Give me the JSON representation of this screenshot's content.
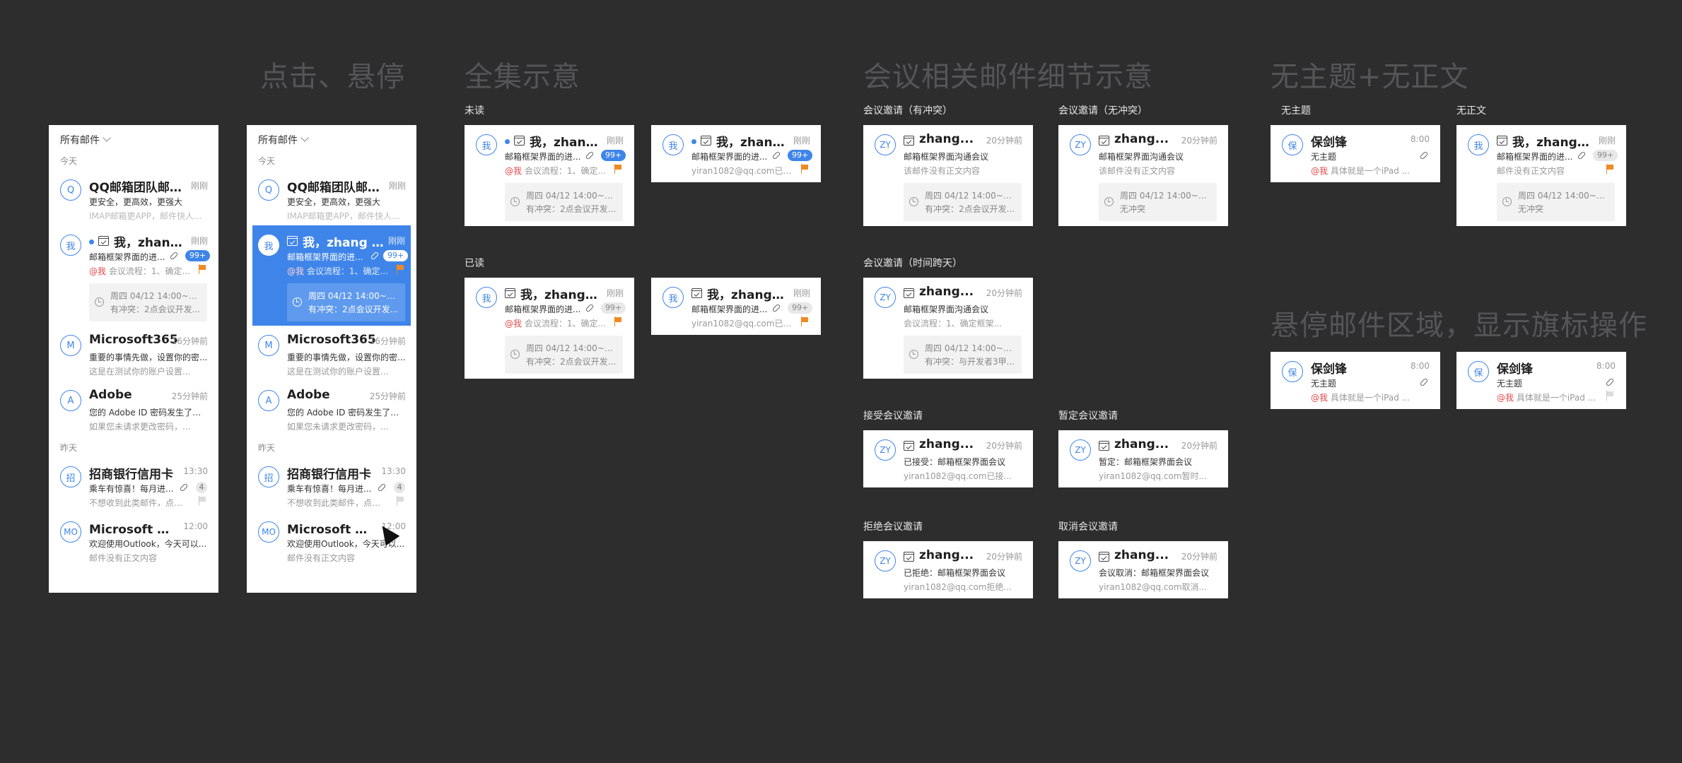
{
  "sections": {
    "hover": "点击、悬停",
    "overview": "全集示意",
    "meeting": "会议相关邮件细节示意",
    "empty": "无主题+无正文",
    "hover_flag": "悬停邮件区域，显示旗标操作"
  },
  "labels": {
    "unread": "未读",
    "read": "已读",
    "conflict": "会议邀请（有冲突）",
    "noconflict": "会议邀请（无冲突）",
    "crossday": "会议邀请（时间跨天）",
    "accept": "接受会议邀请",
    "tentative": "暂定会议邀请",
    "decline": "拒绝会议邀请",
    "cancel": "取消会议邀请",
    "nosubject": "无主题",
    "nobody": "无正文"
  },
  "panel": {
    "folder": "所有邮件",
    "today": "今天",
    "yesterday": "昨天",
    "mails": [
      {
        "avatar": "Q",
        "sender": "QQ邮箱团队邮箱...",
        "time": "刚刚",
        "subject": "更安全，更高效，更强大",
        "preview": "IMAP邮箱更APP，邮件快人..."
      },
      {
        "avatar": "我",
        "sender": "我，zhang...",
        "sender_sel": "我，zhang Yi...",
        "time": "刚刚",
        "subject": "邮箱框架界面的进...",
        "badge": "99+",
        "at": "@我",
        "preview": "会议流程：1、确定...",
        "mtg1": "周四 04/12 14:00~17...",
        "mtg2": "有冲突：2点会议开发..."
      },
      {
        "avatar": "M",
        "sender": "Microsoft365",
        "time": "16分钟前",
        "subject": "重要的事情先做，设置你的密...",
        "preview": "这是在测试你的账户设置..."
      },
      {
        "avatar": "A",
        "sender": "Adobe",
        "time": "25分钟前",
        "subject": "您的 Adobe ID 密码发生了变化",
        "preview": "如果您未请求更改密码，..."
      },
      {
        "avatar": "招",
        "sender": "招商银行信用卡",
        "time": "13:30",
        "subject": "乘车有惊喜！每月进...",
        "count": "4",
        "preview": "不想收到此类邮件，点击..."
      },
      {
        "avatar": "MO",
        "sender": "Microsoft 微软...",
        "time": "12:00",
        "subject": "欢迎使用Outlook，今天可以...",
        "preview": "邮件没有正文内容"
      }
    ]
  },
  "overview": {
    "full": {
      "avatar": "我",
      "sender": "我，zhang...",
      "sender_read": "我，zhang Yi...",
      "time": "刚刚",
      "subject": "邮箱框架界面的进...",
      "badge": "99+",
      "at": "@我",
      "preview": "会议流程：1、确定...",
      "mtg1": "周四 04/12 14:00~17...",
      "mtg2": "有冲突：2点会议开发..."
    },
    "short": {
      "avatar": "我",
      "sender": "我，zhang...",
      "sender_read": "我，zhang Yi...",
      "time": "刚刚",
      "subject": "邮箱框架界面的进...",
      "badge": "99+",
      "preview": "yiran1082@qq.com已接..."
    }
  },
  "meeting": {
    "conflict": {
      "avatar": "ZY",
      "sender": "zhang...",
      "time": "20分钟前",
      "subject": "邮箱框架界面沟通会议",
      "preview": "该邮件没有正文内容",
      "mtg1": "周四 04/12 14:00~17...",
      "mtg2": "有冲突：2点会议开发..."
    },
    "noconflict": {
      "avatar": "ZY",
      "sender": "zhang...",
      "time": "20分钟前",
      "subject": "邮箱框架界面沟通会议",
      "preview": "该邮件没有正文内容",
      "mtg1": "周四 04/12 14:00~17...",
      "mtg2": "无冲突"
    },
    "crossday": {
      "avatar": "ZY",
      "sender": "zhang...",
      "time": "20分钟前",
      "subject": "邮箱框架界面沟通会议",
      "preview": "会议流程：1、确定框架...",
      "mtg1": "周四 04/12 14:00~17...",
      "mtg2": "有冲突：与开发者3甲..."
    },
    "accept": {
      "avatar": "ZY",
      "sender": "zhang...",
      "time": "20分钟前",
      "subject": "已接受：邮箱框架界面会议",
      "preview": "yiran1082@qq.com已接..."
    },
    "tentative": {
      "avatar": "ZY",
      "sender": "zhang...",
      "time": "20分钟前",
      "subject": "暂定：邮箱框架界面会议",
      "preview": "yiran1082@qq.com暂时..."
    },
    "decline": {
      "avatar": "ZY",
      "sender": "zhang...",
      "time": "20分钟前",
      "subject": "已拒绝：邮箱框架界面会议",
      "preview": "yiran1082@qq.com拒绝..."
    },
    "cancel": {
      "avatar": "ZY",
      "sender": "zhang...",
      "time": "20分钟前",
      "subject": "会议取消：邮箱框架界面会议",
      "preview": "yiran1082@qq.com取消..."
    }
  },
  "empty": {
    "nosub": {
      "avatar": "保",
      "sender": "保剑锋",
      "time": "8:00",
      "subject": "无主题",
      "at": "@我",
      "preview": "具体就是一个iPad ..."
    },
    "nobody": {
      "avatar": "我",
      "sender": "我，zhang Yi...",
      "time": "刚刚",
      "subject": "邮箱框架界面的进...",
      "badge": "99+",
      "preview": "邮件没有正文内容",
      "mtg1": "周四 04/12 14:00~17...",
      "mtg2": "无冲突"
    }
  },
  "colors": {
    "accent": "#3f85e9",
    "flag": "#f08a24",
    "background": "#2d2d2e",
    "mention": "#e34b4b"
  }
}
